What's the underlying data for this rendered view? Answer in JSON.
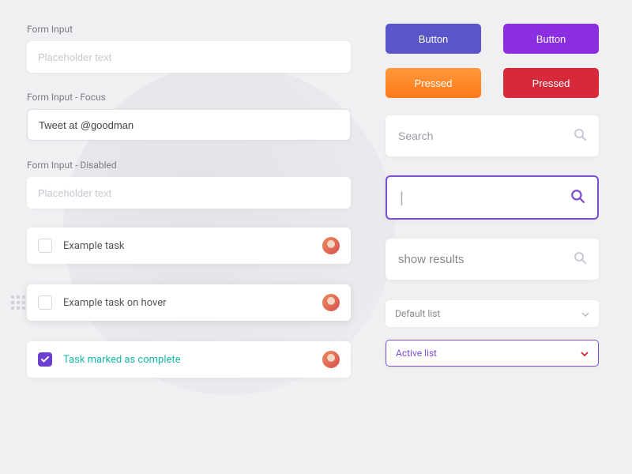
{
  "inputs": {
    "default": {
      "label": "Form Input",
      "placeholder": "Placeholder text"
    },
    "focus": {
      "label": "Form Input - Focus",
      "value": "Tweet at @goodman"
    },
    "disabled": {
      "label": "Form Input - Disabled",
      "placeholder": "Placeholder text"
    }
  },
  "tasks": [
    {
      "text": "Example task"
    },
    {
      "text": "Example task on hover"
    },
    {
      "text": "Task marked as complete"
    }
  ],
  "buttons": {
    "indigo": "Button",
    "purple": "Button",
    "orange": "Pressed",
    "red": "Pressed"
  },
  "search": {
    "placeholder": "Search",
    "focus_value": "|",
    "results_placeholder": "show results"
  },
  "selects": {
    "default": "Default list",
    "active": "Active list"
  }
}
